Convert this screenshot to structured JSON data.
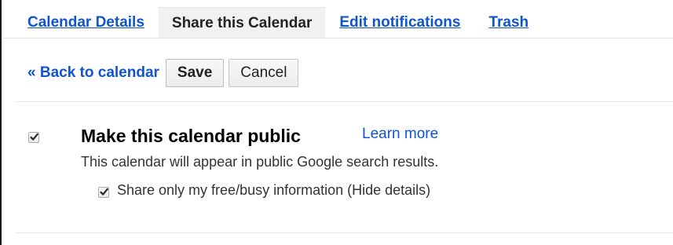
{
  "tabs": [
    {
      "label": "Calendar Details",
      "active": false
    },
    {
      "label": "Share this Calendar",
      "active": true
    },
    {
      "label": "Edit notifications",
      "active": false
    },
    {
      "label": "Trash",
      "active": false
    }
  ],
  "toolbar": {
    "back_label": "« Back to calendar",
    "save_label": "Save",
    "cancel_label": "Cancel"
  },
  "sharing": {
    "public_checked": true,
    "public_title": "Make this calendar public",
    "learn_more": "Learn more",
    "public_description": "This calendar will appear in public Google search results.",
    "freebusy_checked": true,
    "freebusy_label": "Share only my free/busy information (Hide details)"
  },
  "colors": {
    "link": "#1155cc",
    "active_tab_bg": "#f1f1f1",
    "divider": "#e5e5e5"
  },
  "icons": {
    "checkmark": "check-icon"
  }
}
